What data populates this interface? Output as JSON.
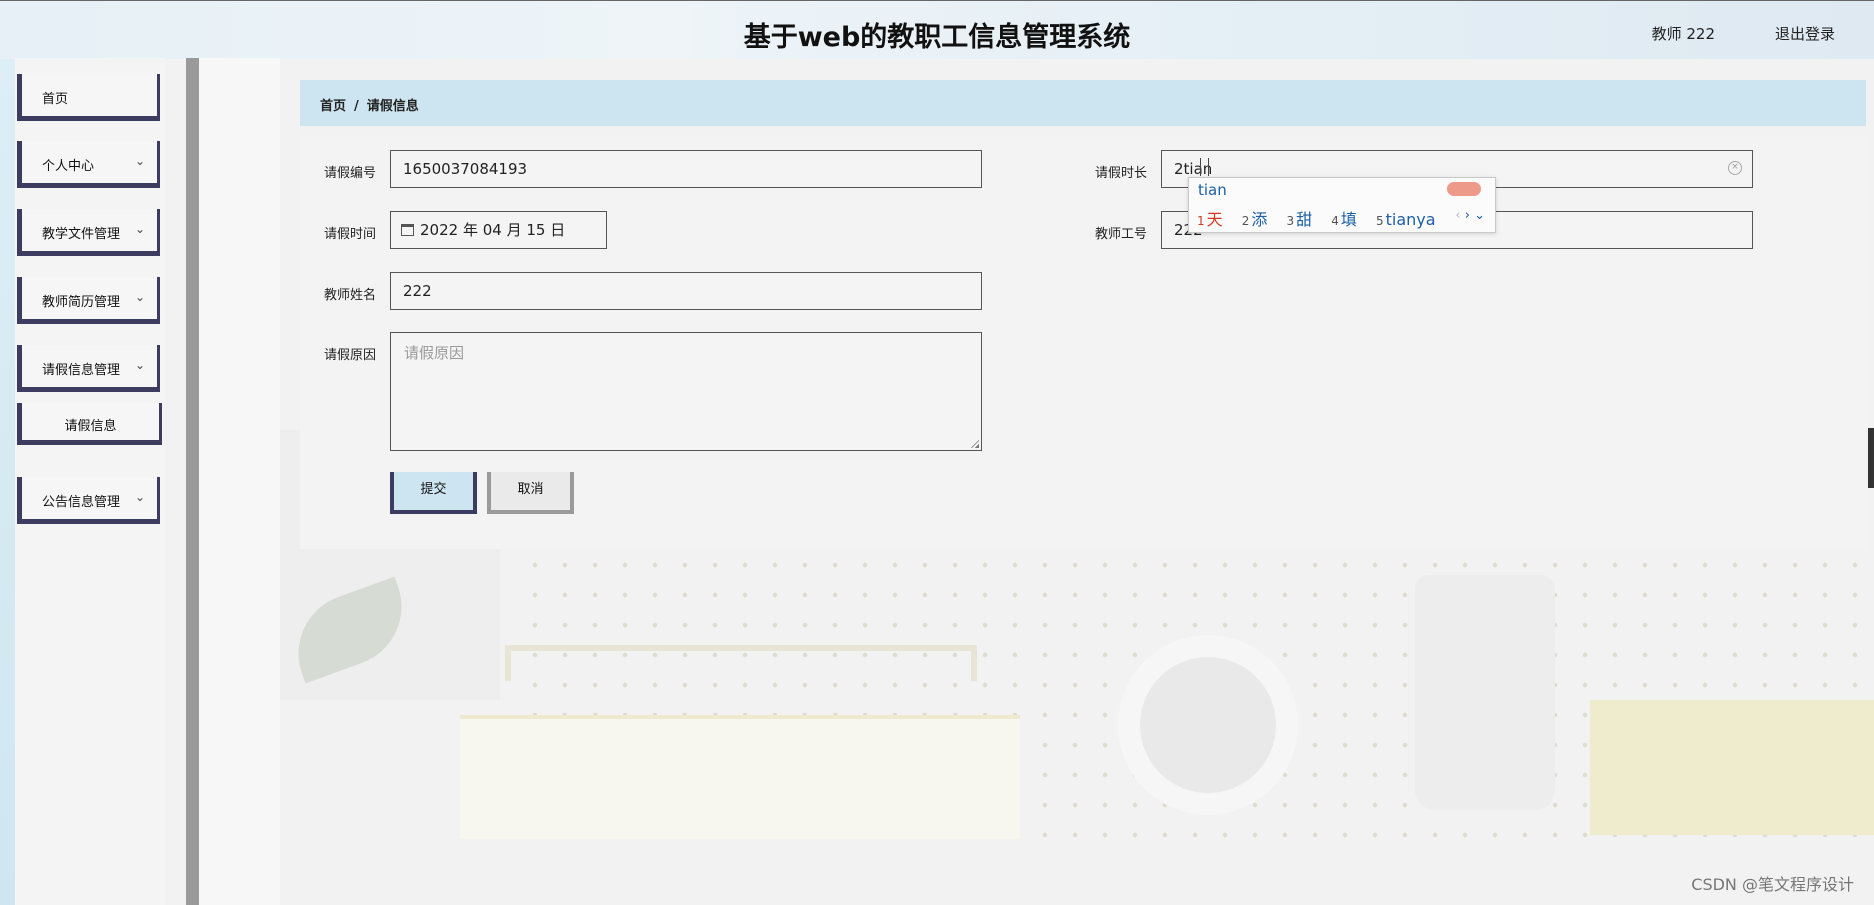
{
  "header": {
    "title": "基于web的教职工信息管理系统",
    "user": "教师 222",
    "logout": "退出登录"
  },
  "sidebar": {
    "items": [
      {
        "label": "首页",
        "has_children": false
      },
      {
        "label": "个人中心",
        "has_children": true
      },
      {
        "label": "教学文件管理",
        "has_children": true
      },
      {
        "label": "教师简历管理",
        "has_children": true
      },
      {
        "label": "请假信息管理",
        "has_children": true
      },
      {
        "label": "请假信息",
        "has_children": false,
        "sub": true
      },
      {
        "label": "公告信息管理",
        "has_children": true
      }
    ]
  },
  "breadcrumb": {
    "home": "首页",
    "separator": "/",
    "current": "请假信息"
  },
  "form": {
    "leave_no": {
      "label": "请假编号",
      "value": "1650037084193"
    },
    "leave_duration": {
      "label": "请假时长",
      "value": "2tian"
    },
    "leave_time": {
      "label": "请假时间",
      "value": "2022 年 04 月 15 日"
    },
    "teacher_no": {
      "label": "教师工号",
      "value": "222"
    },
    "teacher_name": {
      "label": "教师姓名",
      "value": "222"
    },
    "reason": {
      "label": "请假原因",
      "placeholder": "请假原因",
      "value": ""
    },
    "submit": "提交",
    "cancel": "取消"
  },
  "ime": {
    "composition": "tian",
    "candidates": [
      {
        "n": "1",
        "text": "天"
      },
      {
        "n": "2",
        "text": "添"
      },
      {
        "n": "3",
        "text": "甜"
      },
      {
        "n": "4",
        "text": "填"
      },
      {
        "n": "5",
        "text": "tianya"
      }
    ],
    "nav": {
      "prev": "‹",
      "next": "›",
      "more": "⌄"
    }
  },
  "watermark": "CSDN @笔文程序设计",
  "colors": {
    "accent_dark": "#3b3c60",
    "header_bg": "#e6f0f6",
    "breadcrumb_bg": "#cde5f1",
    "ime_highlight": "#d23c1e"
  }
}
